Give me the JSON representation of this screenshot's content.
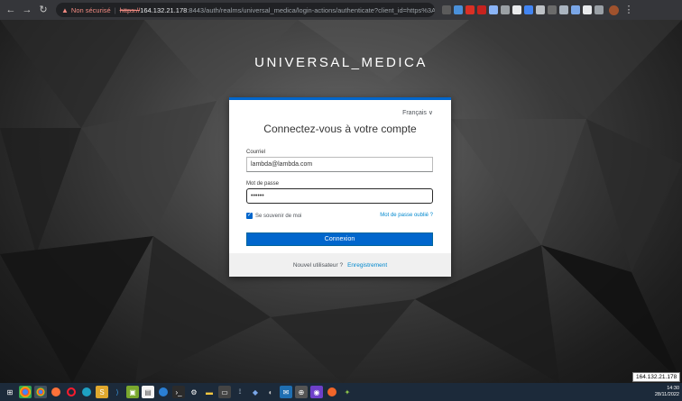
{
  "browser": {
    "not_secure": "Non sécurisé",
    "separator": "|",
    "url_proto": "https://",
    "url_host": "164.132.21.178",
    "url_rest": ":8443/auth/realms/universal_medica/login-actions/authenticate?client_id=https%3A..."
  },
  "realm_title": "UNIVERSAL_MEDICA",
  "login": {
    "language": "Français ∨",
    "title": "Connectez-vous à votre compte",
    "email_label": "Courriel",
    "email_value": "lambda@lambda.com",
    "password_label": "Mot de passe",
    "password_value": "••••••",
    "remember_label": "Se souvenir de moi",
    "remember_checked": true,
    "forgot_link": "Mot de passe oublié ?",
    "submit_label": "Connexion",
    "new_user_text": "Nouvel utilisateur ?",
    "register_link": "Enregistrement"
  },
  "tooltip": "164.132.21.178",
  "taskbar": {
    "time": "14:30",
    "date": "28/11/2022"
  },
  "colors": {
    "accent": "#0066cc",
    "link": "#0088ce",
    "not_secure": "#f28b82"
  }
}
